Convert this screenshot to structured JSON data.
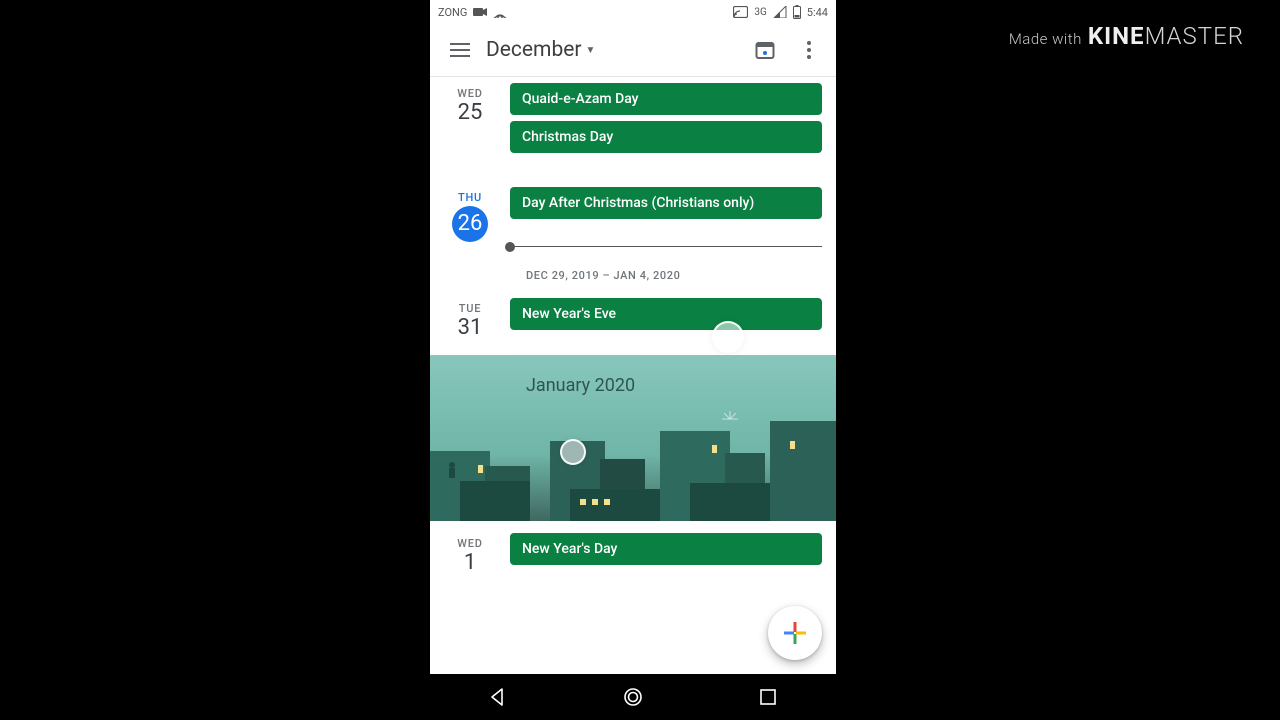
{
  "watermark": {
    "made": "Made with",
    "brand1": "KINE",
    "brand2": "MASTER"
  },
  "statusbar": {
    "carrier": "ZONG",
    "network": "3G",
    "time": "5:44"
  },
  "appbar": {
    "title": "December"
  },
  "days": [
    {
      "dow": "WED",
      "num": "25",
      "today": false,
      "events": [
        "Quaid-e-Azam Day",
        "Christmas Day"
      ]
    },
    {
      "dow": "THU",
      "num": "26",
      "today": true,
      "events": [
        "Day After Christmas (Christians only)"
      ]
    }
  ],
  "week_label": "DEC 29, 2019 – JAN 4, 2020",
  "days2": [
    {
      "dow": "TUE",
      "num": "31",
      "today": false,
      "events": [
        "New Year's Eve"
      ]
    }
  ],
  "month_banner": {
    "label": "January 2020"
  },
  "days3": [
    {
      "dow": "WED",
      "num": "1",
      "today": false,
      "events": [
        "New Year's Day"
      ]
    }
  ]
}
